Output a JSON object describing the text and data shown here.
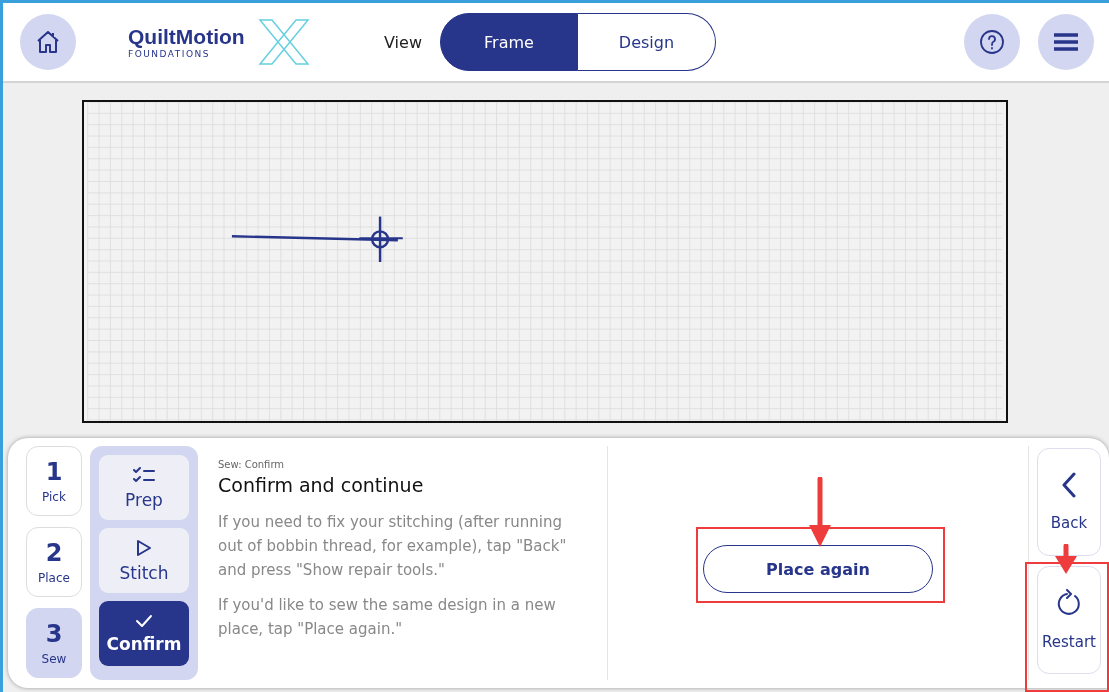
{
  "header": {
    "logo": {
      "name": "QuiltMotion",
      "tagline": "FOUNDATIONS"
    },
    "view_label": "View",
    "view_tabs": [
      {
        "label": "Frame",
        "selected": true
      },
      {
        "label": "Design",
        "selected": false
      }
    ]
  },
  "steps": [
    {
      "number": "1",
      "label": "Pick",
      "selected": false
    },
    {
      "number": "2",
      "label": "Place",
      "selected": false
    },
    {
      "number": "3",
      "label": "Sew",
      "selected": true
    }
  ],
  "substeps": [
    {
      "kind": "prep",
      "label": "Prep",
      "selected": false
    },
    {
      "kind": "stitch",
      "label": "Stitch",
      "selected": false
    },
    {
      "kind": "confirm",
      "label": "Confirm",
      "selected": true
    }
  ],
  "instructions": {
    "breadcrumb": "Sew: Confirm",
    "title": "Confirm and continue",
    "paragraphs": [
      "If you need to fix your stitching (after running out of bobbin thread, for example), tap \"Back\" and press \"Show repair tools.\"",
      "If you'd like to sew the same design in a new place, tap \"Place again.\""
    ]
  },
  "action_button": "Place again",
  "side_buttons": [
    {
      "kind": "back",
      "label": "Back"
    },
    {
      "kind": "restart",
      "label": "Restart"
    }
  ]
}
